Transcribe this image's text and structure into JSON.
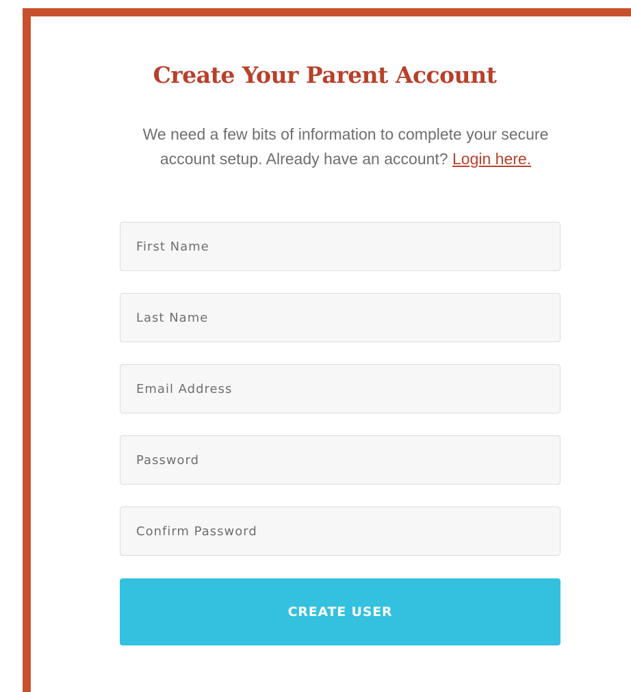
{
  "form": {
    "title": "Create Your Parent Account",
    "intro_text": "We need a few bits of information to complete your secure account setup. Already have an account?",
    "login_link": "Login here.",
    "fields": {
      "first_name": {
        "placeholder": "First Name",
        "value": ""
      },
      "last_name": {
        "placeholder": "Last Name",
        "value": ""
      },
      "email": {
        "placeholder": "Email Address",
        "value": ""
      },
      "password": {
        "placeholder": "Password",
        "value": ""
      },
      "confirm_password": {
        "placeholder": "Confirm Password",
        "value": ""
      }
    },
    "submit_label": "CREATE USER"
  },
  "colors": {
    "accent": "#c9502d",
    "title": "#b8402a",
    "button": "#33c1df"
  }
}
